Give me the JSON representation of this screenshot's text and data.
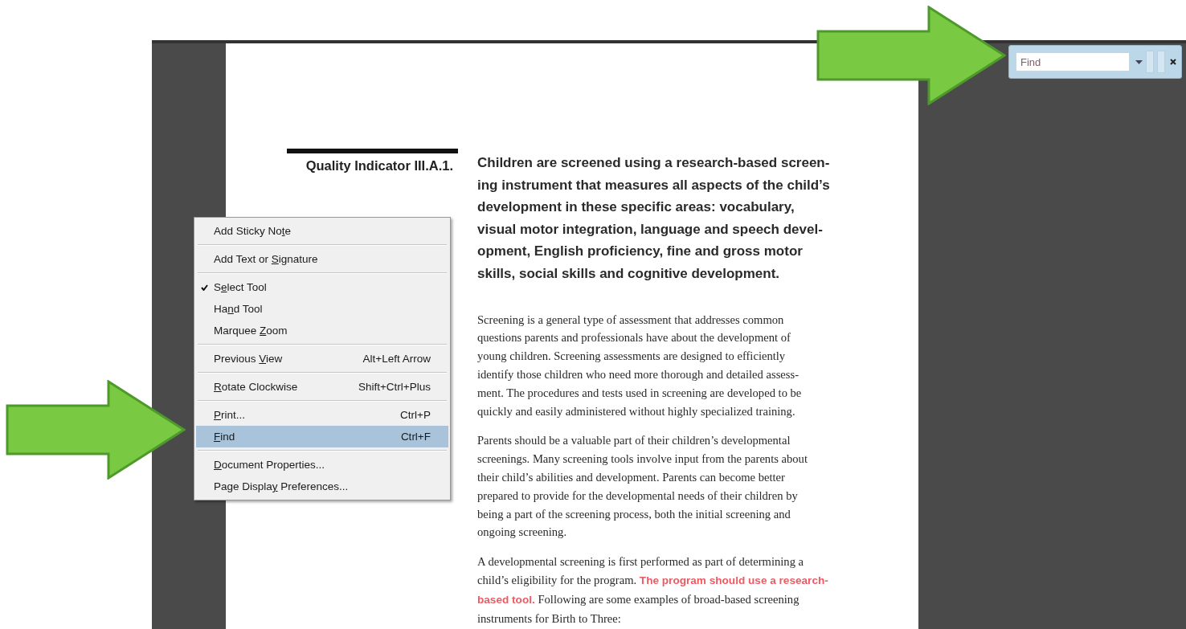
{
  "document": {
    "indicator": {
      "label": "Quality Indicator III.A.1."
    },
    "heading_lines": [
      "Children are screened using a research-based screen-",
      "ing instrument that measures all aspects of the child’s",
      "development in these specific areas: vocabulary,",
      "visual motor integration, language and speech devel-",
      "opment, English proficiency, fine and gross motor",
      "skills, social skills and cognitive development."
    ],
    "paragraphs": [
      {
        "lines": [
          "Screening is a general type of assessment that addresses common",
          "questions parents and professionals have about the development of",
          "young children. Screening assessments are designed to efficiently",
          "identify those children who need more thorough and detailed assess-",
          "ment. The procedures and tests used in screening are developed to be",
          "quickly and easily administered without highly specialized training."
        ]
      },
      {
        "lines": [
          "Parents should be a valuable part of their children’s developmental",
          "screenings. Many screening tools involve input from the parents about",
          "their child’s abilities and development. Parents can become better",
          "prepared to provide for the developmental needs of their children by",
          "being a part of the screening process, both the initial screening and",
          "ongoing screening."
        ]
      },
      {
        "lines": [
          "A developmental screening is first performed as part of determining a",
          "child’s eligibility for the program. **The program should use a research-**",
          "**based tool.** Following are some examples of broad-based screening",
          "instruments for Birth to Three:"
        ]
      }
    ]
  },
  "find_bar": {
    "placeholder": "Find"
  },
  "context_menu": [
    {
      "kind": "item",
      "label": [
        {
          "text": "Add Sticky No"
        },
        {
          "text": "t",
          "underline": true
        },
        {
          "text": "e"
        }
      ],
      "checked": false,
      "selected": false
    },
    {
      "kind": "separator"
    },
    {
      "kind": "item",
      "label": [
        {
          "text": "Add Text or "
        },
        {
          "text": "S",
          "underline": true
        },
        {
          "text": "ignature"
        }
      ],
      "checked": false,
      "selected": false
    },
    {
      "kind": "separator"
    },
    {
      "kind": "item",
      "label": [
        {
          "text": "S"
        },
        {
          "text": "e",
          "underline": true
        },
        {
          "text": "lect Tool"
        }
      ],
      "checked": true,
      "selected": false
    },
    {
      "kind": "item",
      "label": [
        {
          "text": "Ha"
        },
        {
          "text": "n",
          "underline": true
        },
        {
          "text": "d Tool"
        }
      ],
      "checked": false,
      "selected": false
    },
    {
      "kind": "item",
      "label": [
        {
          "text": "Marquee "
        },
        {
          "text": "Z",
          "underline": true
        },
        {
          "text": "oom"
        }
      ],
      "checked": false,
      "selected": false
    },
    {
      "kind": "separator"
    },
    {
      "kind": "item",
      "label": [
        {
          "text": "Previous "
        },
        {
          "text": "V",
          "underline": true
        },
        {
          "text": "iew"
        }
      ],
      "shortcut": "Alt+Left Arrow",
      "checked": false,
      "selected": false
    },
    {
      "kind": "separator"
    },
    {
      "kind": "item",
      "label": [
        {
          "text": "R",
          "underline": true
        },
        {
          "text": "otate Clockwise"
        }
      ],
      "shortcut": "Shift+Ctrl+Plus",
      "checked": false,
      "selected": false
    },
    {
      "kind": "separator"
    },
    {
      "kind": "item",
      "label": [
        {
          "text": "P",
          "underline": true
        },
        {
          "text": "rint..."
        }
      ],
      "shortcut": "Ctrl+P",
      "checked": false,
      "selected": false
    },
    {
      "kind": "item",
      "label": [
        {
          "text": "F",
          "underline": true
        },
        {
          "text": "ind"
        }
      ],
      "shortcut": "Ctrl+F",
      "checked": false,
      "selected": true
    },
    {
      "kind": "separator"
    },
    {
      "kind": "item",
      "label": [
        {
          "text": "D",
          "underline": true
        },
        {
          "text": "ocument Properties..."
        }
      ],
      "checked": false,
      "selected": false
    },
    {
      "kind": "item",
      "label": [
        {
          "text": "Page Displa"
        },
        {
          "text": "y",
          "underline": true
        },
        {
          "text": " Preferences..."
        }
      ],
      "checked": false,
      "selected": false
    }
  ]
}
